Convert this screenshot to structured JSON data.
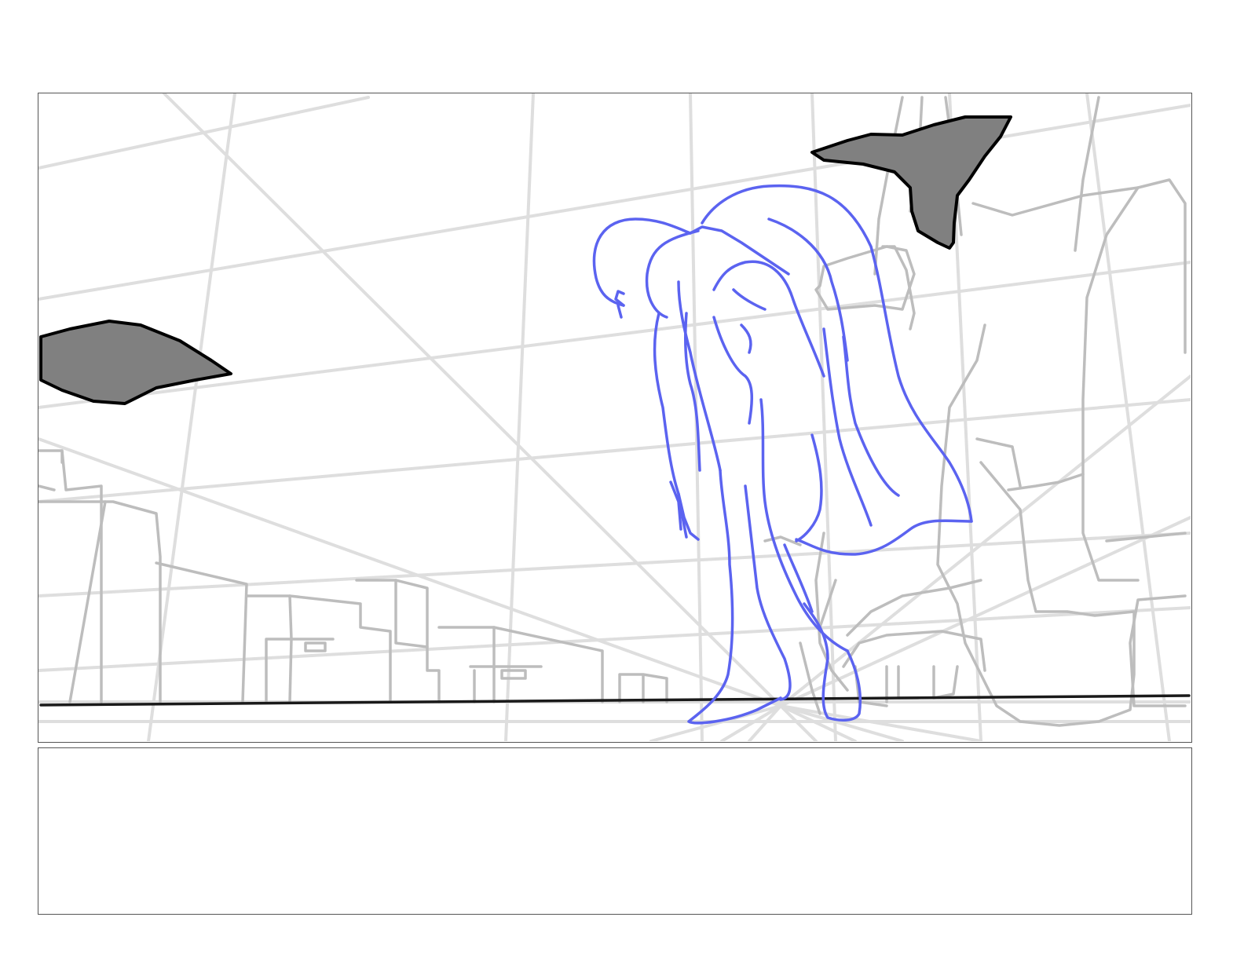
{
  "storyboard": {
    "notes_text": ""
  },
  "colors": {
    "perspective_grid": "#dcdcdc",
    "background_sketch": "#bdbdbd",
    "figure_line": "#5b63f0",
    "horizon_line": "#1a1a1a",
    "shadow_fill": "#808080",
    "shadow_outline": "#000000",
    "panel_border": "#555555"
  },
  "icons": {
    "figure": "bent-over-figure-sketch",
    "background": "city-skyline-sketch"
  }
}
